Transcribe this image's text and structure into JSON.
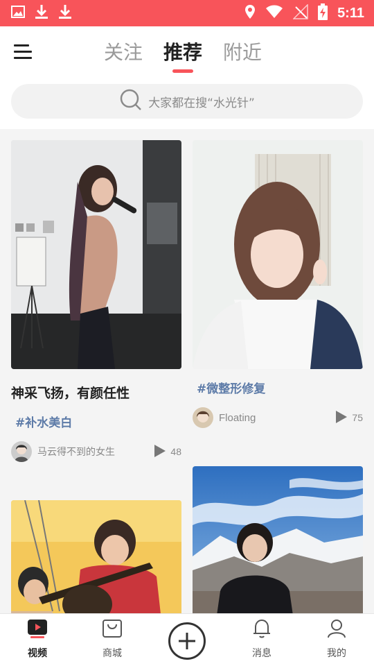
{
  "status_bar": {
    "time": "5:11",
    "left_icons": [
      "image-icon",
      "download-icon",
      "download-icon"
    ],
    "right_icons": [
      "location-icon",
      "wifi-icon",
      "no-signal-icon",
      "battery-charging-icon"
    ],
    "color": "#f8545a"
  },
  "header": {
    "menu_icon": "hamburger-menu-icon",
    "tabs": [
      {
        "label": "关注",
        "active": false
      },
      {
        "label": "推荐",
        "active": true
      },
      {
        "label": "附近",
        "active": false
      }
    ],
    "search_placeholder": "大家都在搜“水光针”"
  },
  "feed": [
    {
      "title": "神采飞扬，有颜任性",
      "tag": "#补水美白",
      "author": "马云得不到的女生",
      "plays": "48"
    },
    {
      "title": "",
      "tag": "#微整形修复",
      "author": "Floating",
      "plays": "75"
    },
    {
      "title": "",
      "tag": "",
      "author": "",
      "plays": ""
    },
    {
      "title": "",
      "tag": "",
      "author": "",
      "plays": ""
    }
  ],
  "bottom_nav": [
    {
      "label": "视频",
      "icon": "video-play-icon",
      "active": true
    },
    {
      "label": "商城",
      "icon": "shopping-bag-icon",
      "active": false
    },
    {
      "label": "",
      "icon": "add-circle-icon",
      "active": false
    },
    {
      "label": "消息",
      "icon": "bell-icon",
      "active": false
    },
    {
      "label": "我的",
      "icon": "user-icon",
      "active": false
    }
  ],
  "accent_color": "#f8545a",
  "tag_color": "#5d7ba8"
}
